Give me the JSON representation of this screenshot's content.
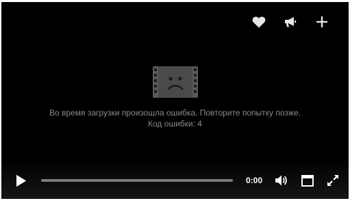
{
  "error": {
    "icon": "sad-film-icon",
    "message": "Во время загрузки произошла ошибка. Повторите попытку позже.",
    "code": "Код ошибки: 4"
  },
  "top_actions": [
    {
      "icon": "heart-icon"
    },
    {
      "icon": "megaphone-icon"
    },
    {
      "icon": "plus-icon"
    }
  ],
  "controls": {
    "play_icon": "play-icon",
    "time": "0:00",
    "progress": 0,
    "volume_icon": "volume-icon",
    "theater_icon": "theater-mode-icon",
    "fullscreen_icon": "fullscreen-icon"
  },
  "colors": {
    "background": "#000000",
    "text_muted": "#8a8a8a",
    "icon": "#e6e6e6",
    "progress_track": "#7c7c7c"
  }
}
